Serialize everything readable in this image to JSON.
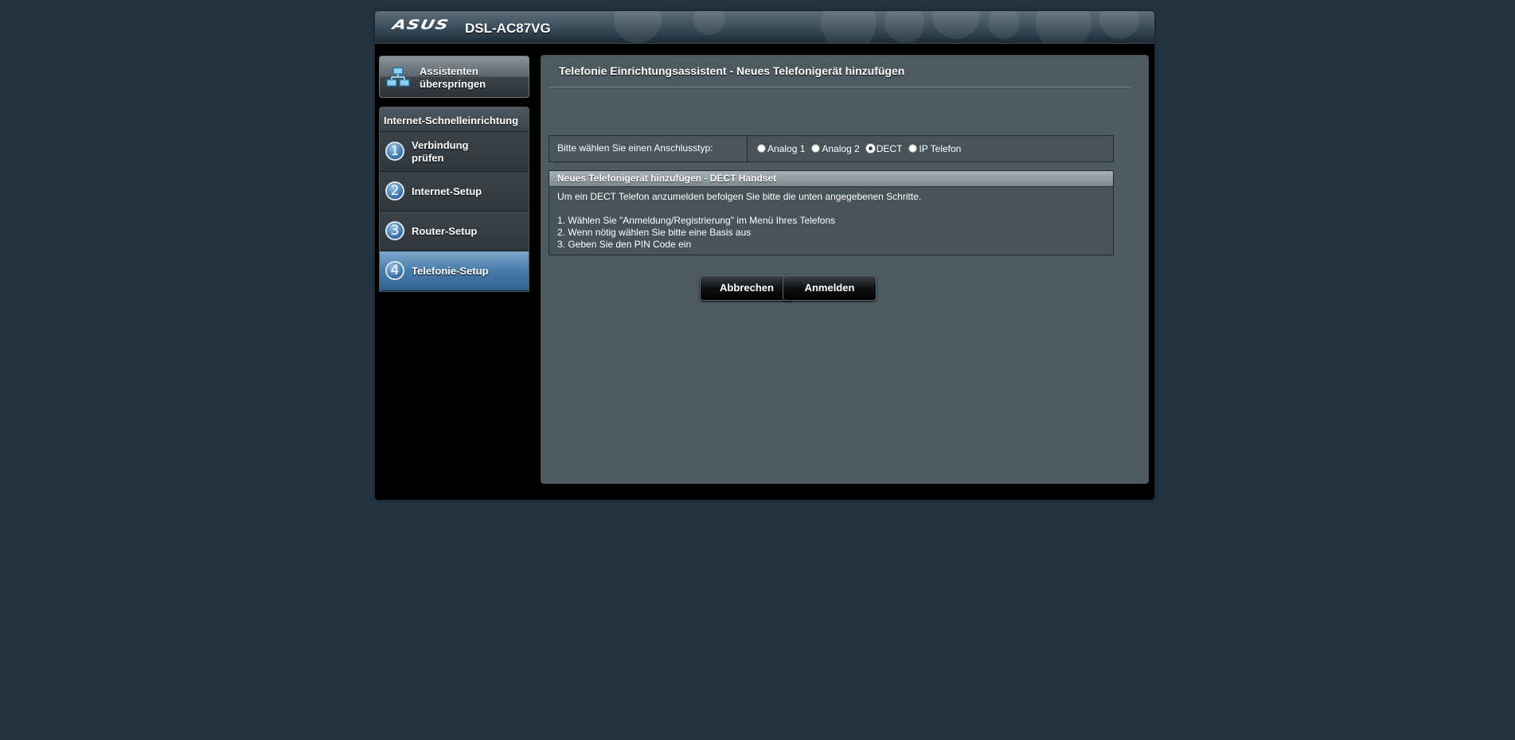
{
  "header": {
    "logo": "ASUS",
    "model": "DSL-AC87VG"
  },
  "sidebar": {
    "skip_button_label": "Assistenten überspringen",
    "skip_icon": "network-icon",
    "quicksetup_title": "Internet-Schnelleinrichtung",
    "steps": [
      {
        "number": "1",
        "label": "Verbindung prüfen",
        "active": false
      },
      {
        "number": "2",
        "label": "Internet-Setup",
        "active": false
      },
      {
        "number": "3",
        "label": "Router-Setup",
        "active": false
      },
      {
        "number": "4",
        "label": "Telefonie-Setup",
        "active": true
      }
    ]
  },
  "main": {
    "title": "Telefonie Einrichtungsassistent - Neues Telefonigerät hinzufügen",
    "connection_label": "Bitte wählen Sie einen Anschlusstyp:",
    "connection_options": [
      {
        "label": "Analog 1",
        "checked": false
      },
      {
        "label": "Analog 2",
        "checked": false
      },
      {
        "label": "DECT",
        "checked": true
      },
      {
        "label": "IP Telefon",
        "checked": false
      }
    ],
    "info": {
      "title": "Neues Telefonigerät hinzufügen - DECT Handset",
      "intro": "Um ein DECT Telefon anzumelden befolgen Sie bitte die unten angegebenen Schritte.",
      "steps": [
        "1. Wählen Sie \"Anmeldung/Registrierung\" im Menü Ihres Telefons",
        "2. Wenn nötig wählen Sie bitte eine Basis aus",
        "3. Geben Sie den PIN Code ein"
      ]
    },
    "cancel_label": "Abbrechen",
    "register_label": "Anmelden"
  },
  "colors": {
    "background": "#22323f",
    "panel": "#4d5a60",
    "active_step": "#4b7eab"
  }
}
